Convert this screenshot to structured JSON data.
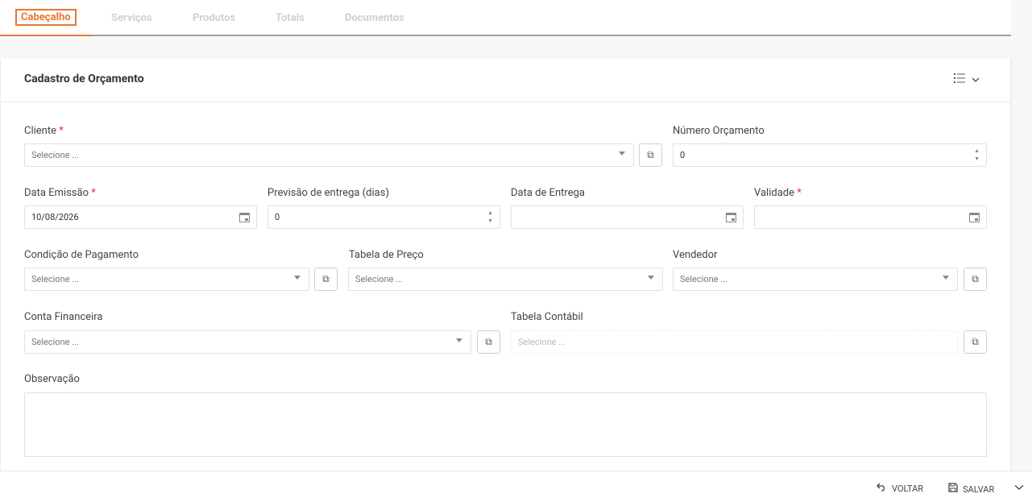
{
  "tabs": [
    {
      "label": "Cabeçalho",
      "active": true
    },
    {
      "label": "Serviços"
    },
    {
      "label": "Produtos"
    },
    {
      "label": "Totais"
    },
    {
      "label": "Documentos"
    }
  ],
  "card": {
    "title": "Cadastro de Orçamento",
    "icons": {
      "list": "list-icon",
      "toggle": "chevron-down-icon"
    }
  },
  "form": {
    "cliente": {
      "label": "Cliente",
      "required": "*",
      "placeholder": "Selecione ..."
    },
    "numero_orcamento": {
      "label": "Número Orçamento",
      "value": "0"
    },
    "data_emissao": {
      "label": "Data Emissão",
      "required": "*",
      "value": "10/08/2026"
    },
    "previsao_entrega": {
      "label": "Previsão de entrega (dias)",
      "value": "0"
    },
    "data_entrega": {
      "label": "Data de Entrega",
      "value": ""
    },
    "validade": {
      "label": "Validade",
      "required": "*",
      "value": ""
    },
    "condicao_pagamento": {
      "label": "Condição de Pagamento",
      "placeholder": "Selecione ..."
    },
    "tabela_preco": {
      "label": "Tabela de Preço",
      "placeholder": "Selecione ..."
    },
    "vendedor": {
      "label": "Vendedor",
      "placeholder": "Selecione ..."
    },
    "conta_financeira": {
      "label": "Conta Financeira",
      "placeholder": "Selecione ..."
    },
    "tabela_contabil": {
      "label": "Tabela Contábil",
      "placeholder": "Selecione ..."
    },
    "observacao": {
      "label": "Observação",
      "value": ""
    }
  },
  "footer": {
    "back_label": "VOLTAR",
    "save_label": "SALVAR"
  },
  "colors": {
    "accent": "#e8772e",
    "required": "#d9342b"
  }
}
